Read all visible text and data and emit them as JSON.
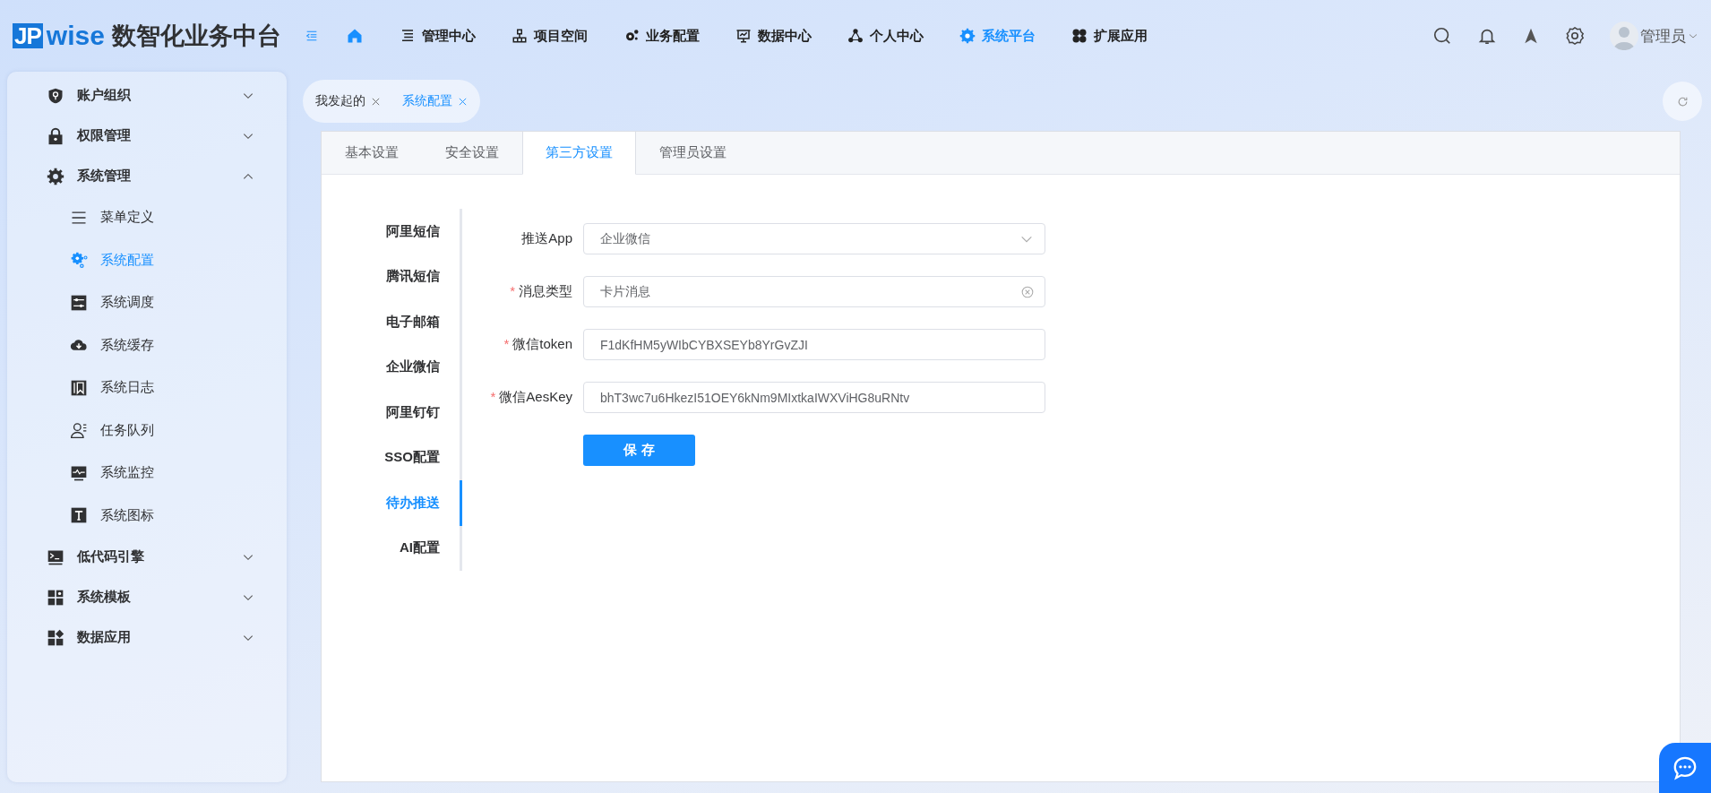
{
  "header": {
    "logo_mark": "JP",
    "logo_word": "wise",
    "title": "数智化业务中台",
    "nav": [
      {
        "label": "管理中心",
        "kind": "menu",
        "selected": false
      },
      {
        "label": "项目空间",
        "kind": "menu",
        "selected": false
      },
      {
        "label": "业务配置",
        "kind": "menu",
        "selected": false
      },
      {
        "label": "数据中心",
        "kind": "menu",
        "selected": false
      },
      {
        "label": "个人中心",
        "kind": "menu",
        "selected": false
      },
      {
        "label": "系统平台",
        "kind": "menu",
        "selected": true
      },
      {
        "label": "扩展应用",
        "kind": "menu",
        "selected": false
      }
    ],
    "user": {
      "name": "管理员"
    }
  },
  "sidebar": {
    "items": [
      {
        "label": "账户组织",
        "expanded": false
      },
      {
        "label": "权限管理",
        "expanded": false
      },
      {
        "label": "系统管理",
        "expanded": true,
        "children": [
          {
            "label": "菜单定义",
            "selected": false
          },
          {
            "label": "系统配置",
            "selected": true
          },
          {
            "label": "系统调度",
            "selected": false
          },
          {
            "label": "系统缓存",
            "selected": false
          },
          {
            "label": "系统日志",
            "selected": false
          },
          {
            "label": "任务队列",
            "selected": false
          },
          {
            "label": "系统监控",
            "selected": false
          },
          {
            "label": "系统图标",
            "selected": false
          }
        ]
      },
      {
        "label": "低代码引擎",
        "expanded": false
      },
      {
        "label": "系统模板",
        "expanded": false
      },
      {
        "label": "数据应用",
        "expanded": false
      }
    ]
  },
  "page_tabs": [
    {
      "label": "我发起的",
      "selected": false
    },
    {
      "label": "系统配置",
      "selected": true
    }
  ],
  "tabs": [
    {
      "label": "基本设置",
      "selected": false
    },
    {
      "label": "安全设置",
      "selected": false
    },
    {
      "label": "第三方设置",
      "selected": true
    },
    {
      "label": "管理员设置",
      "selected": false
    }
  ],
  "config_menu": [
    {
      "label": "阿里短信",
      "selected": false
    },
    {
      "label": "腾讯短信",
      "selected": false
    },
    {
      "label": "电子邮箱",
      "selected": false
    },
    {
      "label": "企业微信",
      "selected": false
    },
    {
      "label": "阿里钉钉",
      "selected": false
    },
    {
      "label": "SSO配置",
      "selected": false
    },
    {
      "label": "待办推送",
      "selected": true
    },
    {
      "label": "AI配置",
      "selected": false
    }
  ],
  "form": {
    "fields": [
      {
        "label": "推送App",
        "kind": "select",
        "value": "企业微信"
      },
      {
        "label": "消息类型",
        "required_mark": "*",
        "kind": "clearable",
        "value": "卡片消息"
      },
      {
        "label": "微信token",
        "required_mark": "*",
        "kind": "input",
        "value": "F1dKfHM5yWIbCYBXSEYb8YrGvZJI"
      },
      {
        "label": "微信AesKey",
        "required_mark": "*",
        "kind": "input",
        "value": "bhT3wc7u6HkezI51OEY6kNm9MIxtkaIWXViHG8uRNtv"
      }
    ],
    "save_button": "保 存"
  }
}
